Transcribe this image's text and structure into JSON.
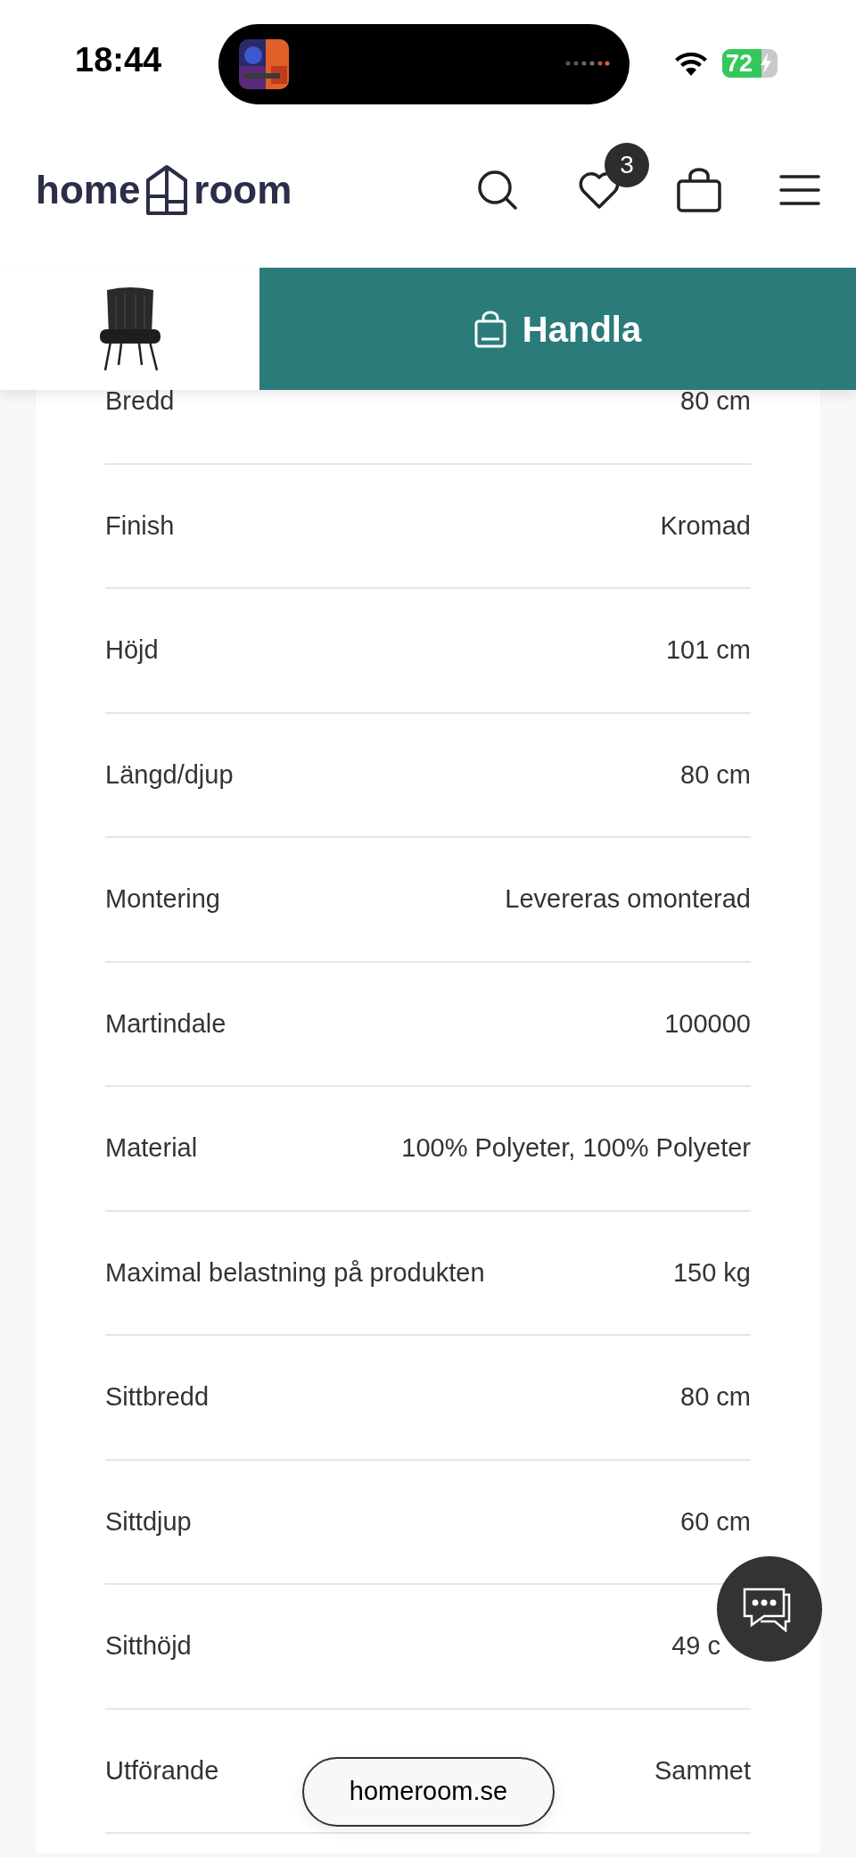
{
  "status_bar": {
    "time": "18:44",
    "battery": "72"
  },
  "header": {
    "logo": {
      "left": "home",
      "right": "room"
    },
    "wishlist_count": "3"
  },
  "sticky_bar": {
    "buy_button": "Handla"
  },
  "specs": [
    {
      "label": "Bredd",
      "value": "80 cm"
    },
    {
      "label": "Finish",
      "value": "Kromad"
    },
    {
      "label": "Höjd",
      "value": "101 cm"
    },
    {
      "label": "Längd/djup",
      "value": "80 cm"
    },
    {
      "label": "Montering",
      "value": "Levereras omonterad"
    },
    {
      "label": "Martindale",
      "value": "100000"
    },
    {
      "label": "Material",
      "value": "100% Polyeter, 100% Polyeter"
    },
    {
      "label": "Maximal belastning på produkten",
      "value": "150 kg"
    },
    {
      "label": "Sittbredd",
      "value": "80 cm"
    },
    {
      "label": "Sittdjup",
      "value": "60 cm"
    },
    {
      "label": "Sitthöjd",
      "value": "49 c"
    },
    {
      "label": "Utförande",
      "value": "Sammet"
    }
  ],
  "url_pill": "homeroom.se"
}
